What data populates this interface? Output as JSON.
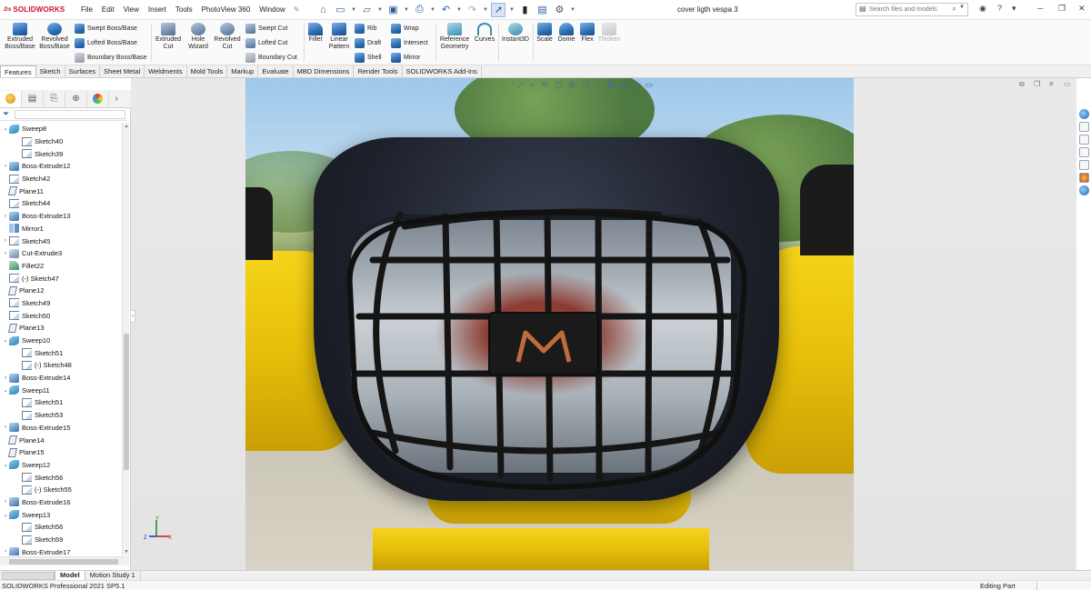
{
  "app": {
    "logo_text": "SOLIDWORKS",
    "document_title": "cover ligth vespa 3"
  },
  "menu": [
    "File",
    "Edit",
    "View",
    "Insert",
    "Tools",
    "PhotoView 360",
    "Window"
  ],
  "search": {
    "placeholder": "Search files and models"
  },
  "ribbon": {
    "extruded_boss": "Extruded Boss/Base",
    "revolved_boss": "Revolved Boss/Base",
    "swept_boss": "Swept Boss/Base",
    "lofted_boss": "Lofted Boss/Base",
    "boundary_boss": "Boundary Boss/Base",
    "extruded_cut": "Extruded Cut",
    "hole_wizard": "Hole Wizard",
    "revolved_cut": "Revolved Cut",
    "swept_cut": "Swept Cut",
    "lofted_cut": "Lofted Cut",
    "boundary_cut": "Boundary Cut",
    "fillet": "Fillet",
    "linear_pattern": "Linear Pattern",
    "rib": "Rib",
    "draft": "Draft",
    "shell": "Shell",
    "wrap": "Wrap",
    "intersect": "Intersect",
    "mirror": "Mirror",
    "reference_geometry": "Reference Geometry",
    "curves": "Curves",
    "instant3d": "Instant3D",
    "scale": "Scale",
    "dome": "Dome",
    "flex": "Flex",
    "thicken": "Thicken"
  },
  "tabs": [
    "Features",
    "Sketch",
    "Surfaces",
    "Sheet Metal",
    "Weldments",
    "Mold Tools",
    "Markup",
    "Evaluate",
    "MBD Dimensions",
    "Render Tools",
    "SOLIDWORKS Add-Ins"
  ],
  "tree": [
    {
      "label": "Sweep8",
      "icon": "sweep",
      "level": 0,
      "expander": "v"
    },
    {
      "label": "Sketch40",
      "icon": "sketch",
      "level": 1,
      "expander": ""
    },
    {
      "label": "Sketch39",
      "icon": "sketch",
      "level": 1,
      "expander": ""
    },
    {
      "label": "Boss-Extrude12",
      "icon": "boss",
      "level": 0,
      "expander": ">"
    },
    {
      "label": "Sketch42",
      "icon": "sketch",
      "level": 0,
      "expander": ""
    },
    {
      "label": "Plane11",
      "icon": "plane",
      "level": 0,
      "expander": ""
    },
    {
      "label": "Sketch44",
      "icon": "sketch",
      "level": 0,
      "expander": ""
    },
    {
      "label": "Boss-Extrude13",
      "icon": "boss",
      "level": 0,
      "expander": ">"
    },
    {
      "label": "Mirror1",
      "icon": "mirror",
      "level": 0,
      "expander": ""
    },
    {
      "label": "Sketch45",
      "icon": "sketch",
      "level": 0,
      "expander": ">"
    },
    {
      "label": "Cut-Extrude3",
      "icon": "cut",
      "level": 0,
      "expander": ">"
    },
    {
      "label": "Fillet22",
      "icon": "fillet",
      "level": 0,
      "expander": ""
    },
    {
      "label": "(-) Sketch47",
      "icon": "sketch",
      "level": 0,
      "expander": ""
    },
    {
      "label": "Plane12",
      "icon": "plane",
      "level": 0,
      "expander": ""
    },
    {
      "label": "Sketch49",
      "icon": "sketch",
      "level": 0,
      "expander": ""
    },
    {
      "label": "Sketch50",
      "icon": "sketch",
      "level": 0,
      "expander": ""
    },
    {
      "label": "Plane13",
      "icon": "plane",
      "level": 0,
      "expander": ""
    },
    {
      "label": "Sweep10",
      "icon": "sweep",
      "level": 0,
      "expander": "v"
    },
    {
      "label": "Sketch51",
      "icon": "sketch",
      "level": 1,
      "expander": ""
    },
    {
      "label": "(-) Sketch48",
      "icon": "sketch",
      "level": 1,
      "expander": ""
    },
    {
      "label": "Boss-Extrude14",
      "icon": "boss",
      "level": 0,
      "expander": ">"
    },
    {
      "label": "Sweep11",
      "icon": "sweep",
      "level": 0,
      "expander": "v"
    },
    {
      "label": "Sketch51",
      "icon": "sketch",
      "level": 1,
      "expander": ""
    },
    {
      "label": "Sketch53",
      "icon": "sketch",
      "level": 1,
      "expander": ""
    },
    {
      "label": "Boss-Extrude15",
      "icon": "boss",
      "level": 0,
      "expander": ">"
    },
    {
      "label": "Plane14",
      "icon": "plane",
      "level": 0,
      "expander": ""
    },
    {
      "label": "Plane15",
      "icon": "plane",
      "level": 0,
      "expander": ""
    },
    {
      "label": "Sweep12",
      "icon": "sweep",
      "level": 0,
      "expander": "v"
    },
    {
      "label": "Sketch56",
      "icon": "sketch",
      "level": 1,
      "expander": ""
    },
    {
      "label": "(-) Sketch55",
      "icon": "sketch",
      "level": 1,
      "expander": ""
    },
    {
      "label": "Boss-Extrude16",
      "icon": "boss",
      "level": 0,
      "expander": ">"
    },
    {
      "label": "Sweep13",
      "icon": "sweep",
      "level": 0,
      "expander": "v"
    },
    {
      "label": "Sketch56",
      "icon": "sketch",
      "level": 1,
      "expander": ""
    },
    {
      "label": "Sketch59",
      "icon": "sketch",
      "level": 1,
      "expander": ""
    },
    {
      "label": "Boss-Extrude17",
      "icon": "boss",
      "level": 0,
      "expander": ">"
    }
  ],
  "bottom_tabs": [
    "Model",
    "Motion Study 1"
  ],
  "status": {
    "version": "SOLIDWORKS Professional 2021 SP5.1",
    "mode": "Editing Part"
  },
  "triad_labels": {
    "x": "X",
    "y": "Y",
    "z": "Z"
  },
  "colors": {
    "brand_red": "#d0102b",
    "accent_blue": "#2a5d9a",
    "body_yellow": "#f0cf14"
  }
}
